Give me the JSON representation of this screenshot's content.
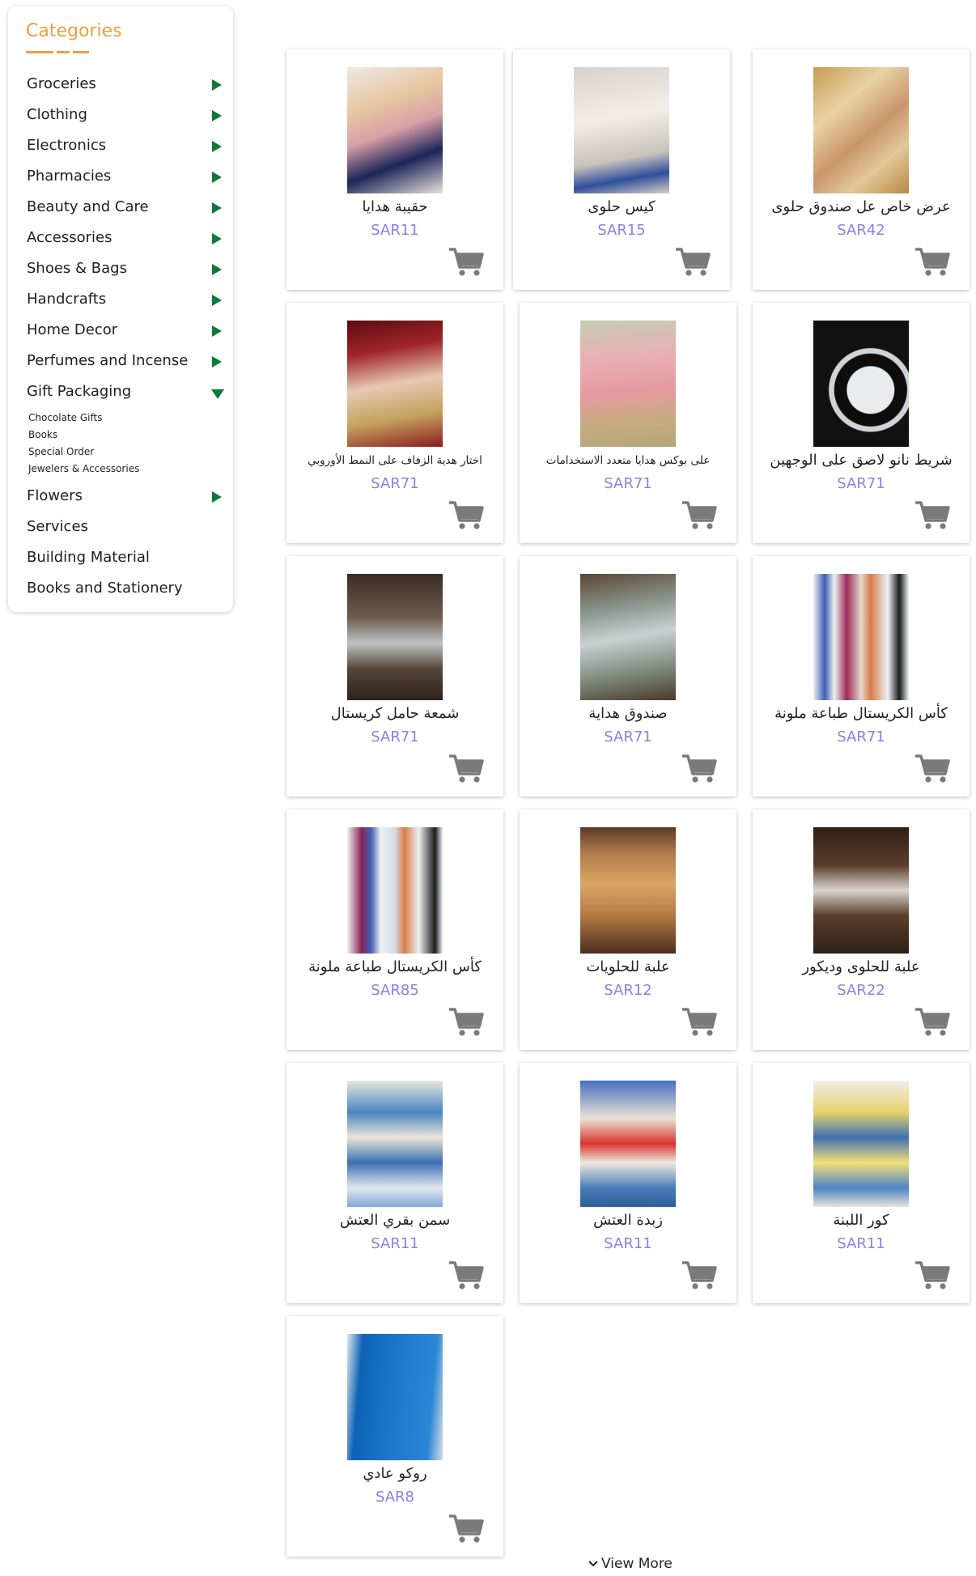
{
  "sidebar": {
    "title": "Categories",
    "categories": [
      {
        "label": "Groceries"
      },
      {
        "label": "Clothing"
      },
      {
        "label": "Electronics"
      },
      {
        "label": "Pharmacies"
      },
      {
        "label": "Beauty and Care"
      },
      {
        "label": "Accessories"
      },
      {
        "label": "Shoes & Bags"
      },
      {
        "label": "Handcrafts"
      },
      {
        "label": "Home Decor"
      },
      {
        "label": "Perfumes and Incense"
      },
      {
        "label": "Gift Packaging"
      },
      {
        "label": "Flowers"
      },
      {
        "label": "Services"
      },
      {
        "label": "Building Material"
      },
      {
        "label": "Books and Stationery"
      }
    ],
    "gift_subcategories": [
      "Chocolate Gifts",
      "Books",
      "Special Order",
      "Jewelers & Accessories"
    ]
  },
  "products": [
    {
      "name": "حقيبة هدايا",
      "price": "SAR11"
    },
    {
      "name": "كيس حلوى",
      "price": "SAR15"
    },
    {
      "name": "عرض خاص عل صندوق حلوى",
      "price": "SAR42"
    },
    {
      "name": "اختار هدية الزفاف على النمط الأوروبي",
      "price": "SAR71"
    },
    {
      "name": "على بوكس هدايا متعدد الاستخدامات",
      "price": "SAR71"
    },
    {
      "name": "شريط نانو لاصق على الوجهين",
      "price": "SAR71"
    },
    {
      "name": "شمعة حامل كريستال",
      "price": "SAR71"
    },
    {
      "name": "صندوق هداية",
      "price": "SAR71"
    },
    {
      "name": "كأس الكريستال طباعة ملونة",
      "price": "SAR71"
    },
    {
      "name": "كأس الكريستال طباعة ملونة",
      "price": "SAR85"
    },
    {
      "name": "علبة للحلويات",
      "price": "SAR12"
    },
    {
      "name": "علبة للحلوى وديكور",
      "price": "SAR22"
    },
    {
      "name": "سمن بقري العتش",
      "price": "SAR11"
    },
    {
      "name": "زبدة العتش",
      "price": "SAR11"
    },
    {
      "name": "كور اللبنة",
      "price": "SAR11"
    },
    {
      "name": "روكو عادي",
      "price": "SAR8"
    }
  ],
  "view_more": "View More",
  "colors": {
    "accent": "#e9a043",
    "arrow": "#0c7a3a",
    "price": "#8880e8",
    "cart_icon": "#7a7a7a"
  },
  "icons": {
    "category_arrow": "triangle-right-icon",
    "category_open": "triangle-down-icon",
    "cart": "shopping-cart-icon",
    "view_more": "chevron-down-icon"
  }
}
